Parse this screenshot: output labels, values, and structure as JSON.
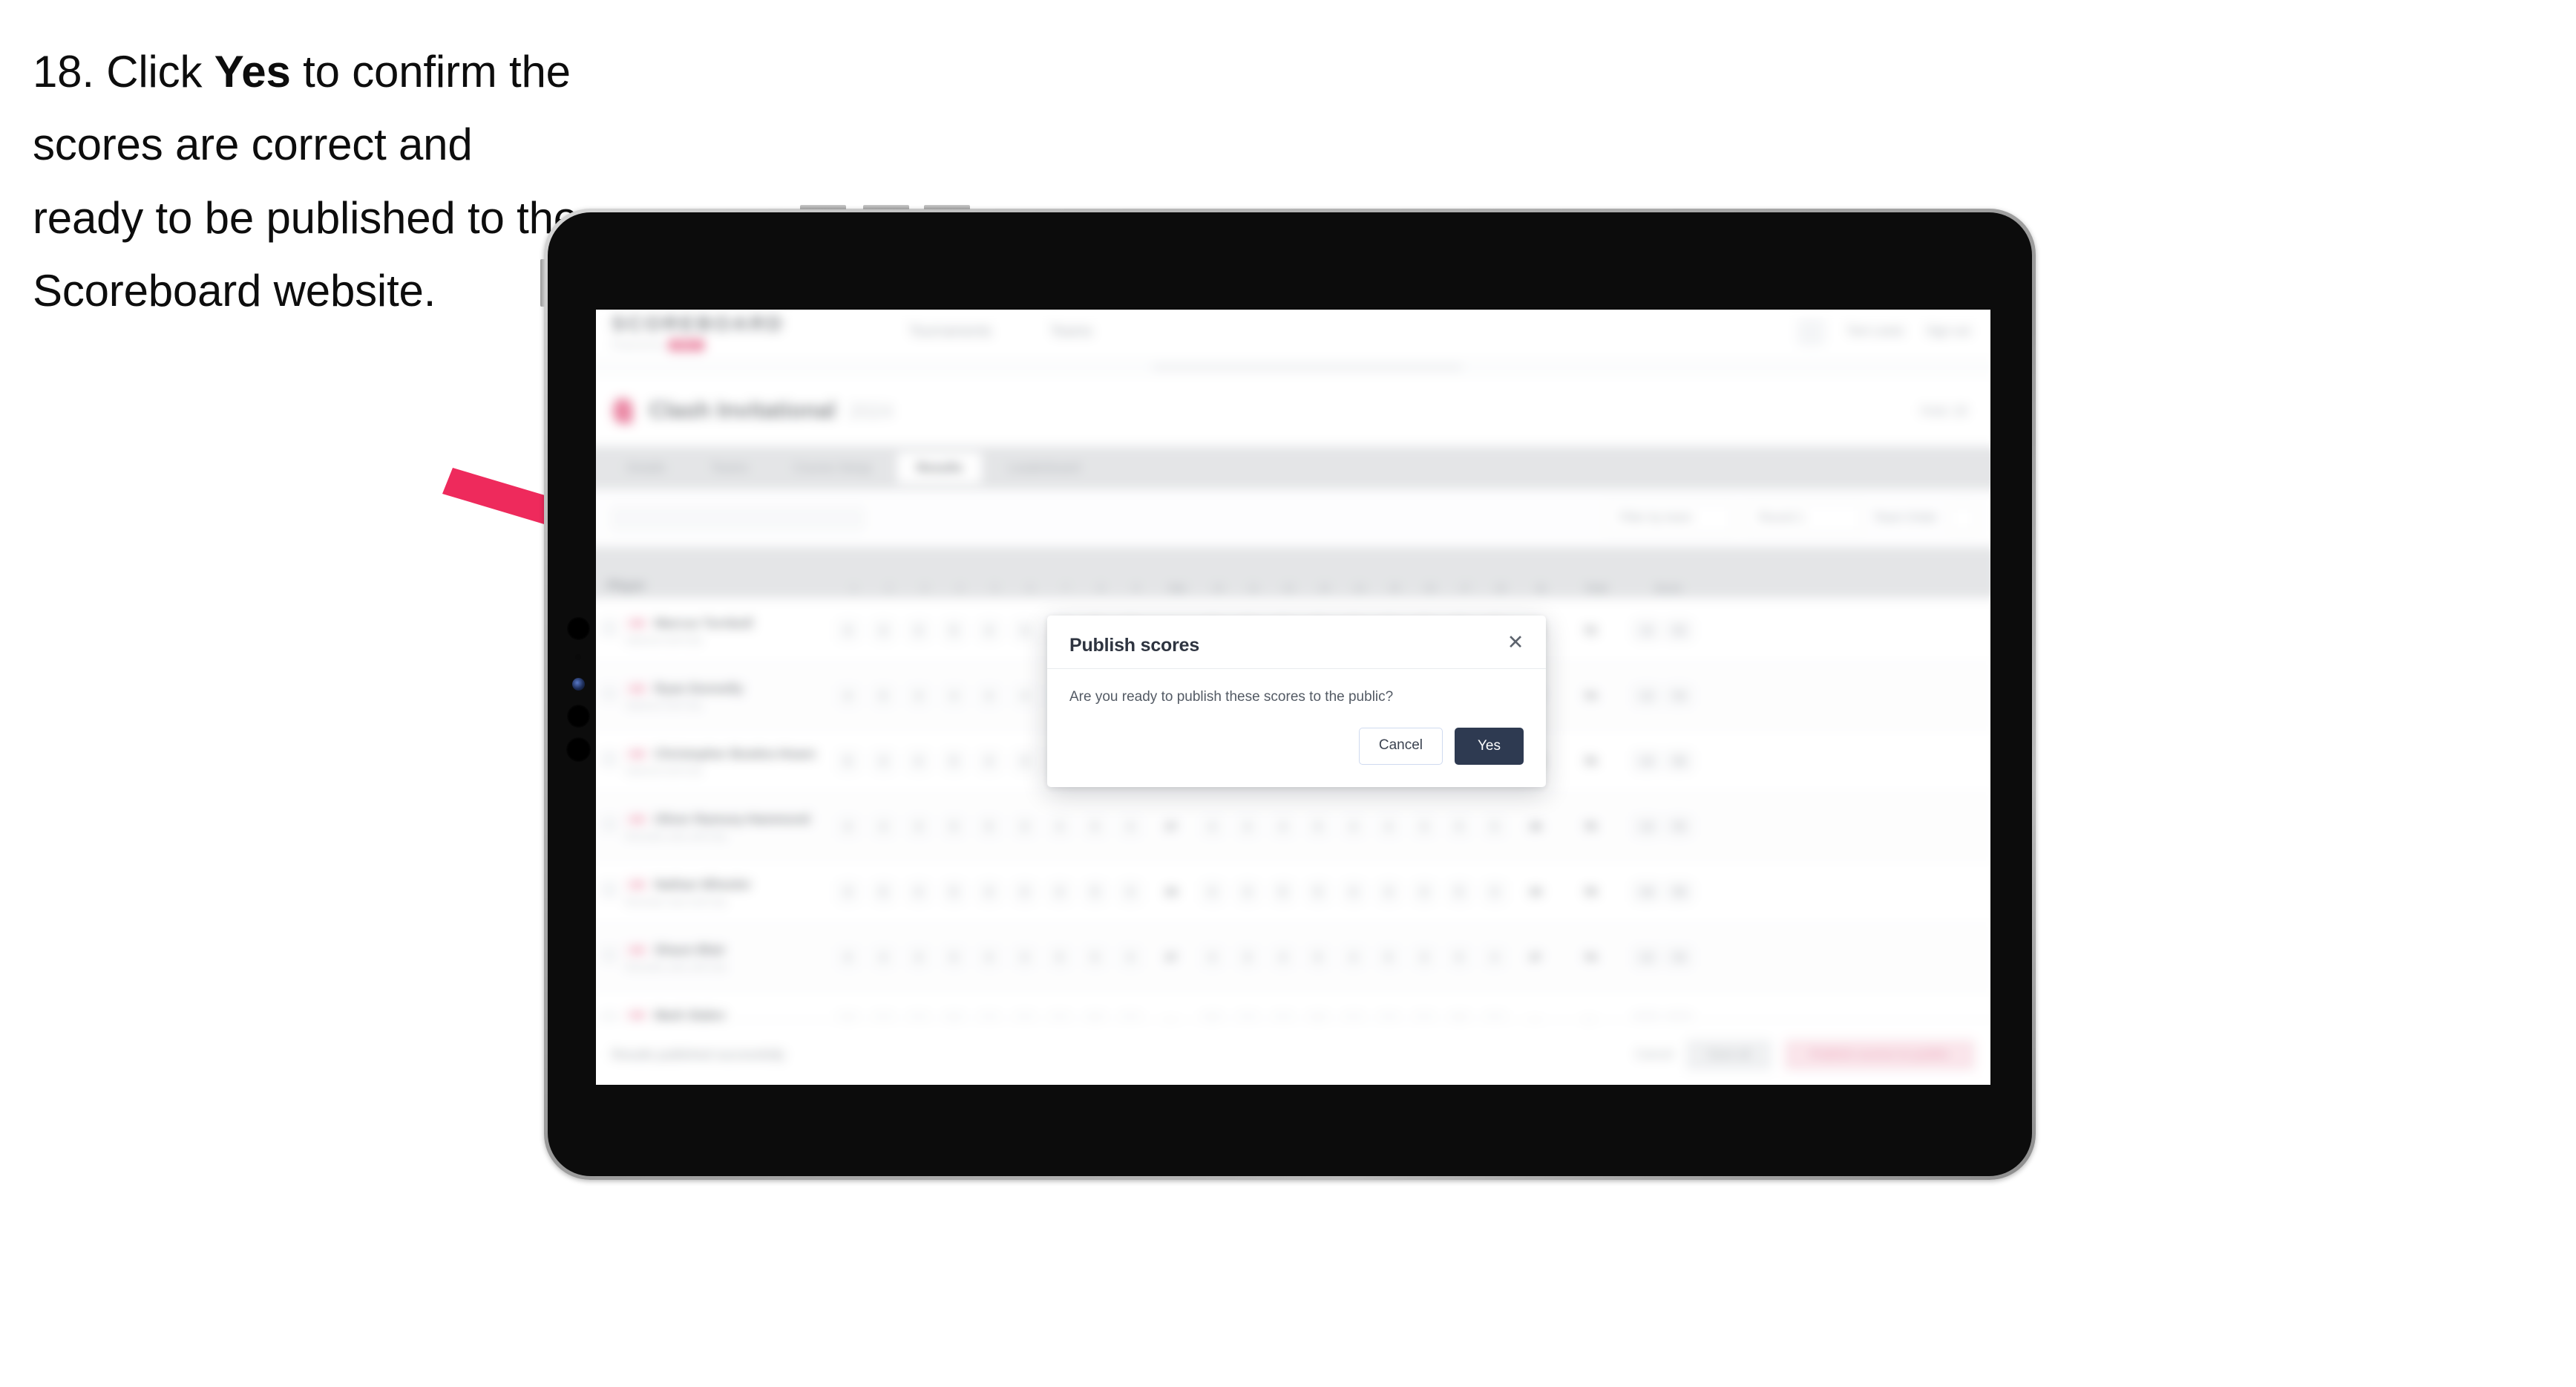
{
  "instruction": {
    "step_number": "18.",
    "text_before": "Click",
    "emphasis": "Yes",
    "text_after": "to confirm the scores are correct and ready to be published to the Scoreboard website."
  },
  "annotation": {
    "arrow_color": "#ee2a5c",
    "arrow_name": "pointer-arrow-to-yes-button"
  },
  "device": {
    "type": "tablet",
    "frame_color": "#b8b8b8",
    "bezel_color": "#0c0c0c"
  },
  "app": {
    "header": {
      "brand": "SCOREBOARD",
      "brand_subtitle": "Powered by",
      "brand_pill": "GOLF",
      "nav": [
        {
          "label": "Tournaments"
        },
        {
          "label": "Teams"
        }
      ],
      "right": [
        {
          "label": "Tom Lewis"
        },
        {
          "label": "Sign out"
        }
      ]
    },
    "title_bar": {
      "title": "Clash Invitational",
      "chip": "2024",
      "action": "Hole 18"
    },
    "tabs": [
      {
        "label": "Details",
        "active": false
      },
      {
        "label": "Teams",
        "active": false
      },
      {
        "label": "Course Setup",
        "active": false
      },
      {
        "label": "Results",
        "active": true
      },
      {
        "label": "Leaderboard",
        "active": false
      }
    ],
    "filters": {
      "search_placeholder": "Search players",
      "pills": [
        {
          "label": "Filter by team"
        },
        {
          "label": "Round 1"
        }
      ],
      "sort_label": "Team Order",
      "icon": "filter-icon"
    },
    "table": {
      "headers": {
        "player": "Player",
        "holes": [
          "1",
          "2",
          "3",
          "4",
          "5",
          "6",
          "7",
          "8",
          "9",
          "10",
          "11",
          "12",
          "13",
          "14",
          "15",
          "16",
          "17",
          "18"
        ],
        "out": "Out",
        "in": "In",
        "total": "Total",
        "score": "Score"
      },
      "rows": [
        {
          "badge": "AM",
          "name": "Marcus Turnbull",
          "club": "Oakmont Golf Club",
          "holes": [
            "4",
            "4",
            "3",
            "5",
            "4",
            "3",
            "4",
            "5",
            "4",
            "4",
            "3",
            "4",
            "5",
            "4",
            "4",
            "3",
            "5",
            "4"
          ],
          "out": "36",
          "in": "36",
          "total": "72",
          "score_a": "-0",
          "score_b": "72"
        },
        {
          "badge": "AM",
          "name": "Ryan Donnelly",
          "club": "Oakmont Golf Club",
          "holes": [
            "4",
            "5",
            "3",
            "4",
            "4",
            "4",
            "4",
            "5",
            "4",
            "4",
            "4",
            "4",
            "5",
            "3",
            "4",
            "4",
            "5",
            "4"
          ],
          "out": "37",
          "in": "37",
          "total": "74",
          "score_a": "+2",
          "score_b": "74"
        },
        {
          "badge": "AM",
          "name": "Christopher Bowles-Hoare",
          "club": "Oakmont Golf Club",
          "holes": [
            "5",
            "4",
            "4",
            "5",
            "4",
            "3",
            "4",
            "5",
            "4",
            "5",
            "3",
            "4",
            "5",
            "4",
            "4",
            "4",
            "5",
            "4"
          ],
          "out": "38",
          "in": "38",
          "total": "76",
          "score_a": "+4",
          "score_b": "76"
        },
        {
          "badge": "AM",
          "name": "Oliver Ramsey-Hammond",
          "club": "Riverside Links Golf Club",
          "holes": [
            "4",
            "4",
            "3",
            "5",
            "5",
            "3",
            "4",
            "5",
            "4",
            "4",
            "4",
            "4",
            "5",
            "4",
            "4",
            "3",
            "5",
            "5"
          ],
          "out": "37",
          "in": "38",
          "total": "75",
          "score_a": "+3",
          "score_b": "75"
        },
        {
          "badge": "AM",
          "name": "Nathan Wheeler",
          "club": "Riverside Links Golf Club",
          "holes": [
            "4",
            "5",
            "4",
            "5",
            "4",
            "4",
            "4",
            "5",
            "4",
            "4",
            "4",
            "5",
            "5",
            "4",
            "4",
            "4",
            "5",
            "4"
          ],
          "out": "39",
          "in": "39",
          "total": "78",
          "score_a": "+6",
          "score_b": "78"
        },
        {
          "badge": "AM",
          "name": "Shaun Blair",
          "club": "Riverside Links Golf Club",
          "holes": [
            "4",
            "4",
            "3",
            "5",
            "4",
            "3",
            "5",
            "5",
            "4",
            "4",
            "3",
            "4",
            "5",
            "4",
            "5",
            "3",
            "5",
            "4"
          ],
          "out": "37",
          "in": "37",
          "total": "74",
          "score_a": "+2",
          "score_b": "74"
        },
        {
          "badge": "AM",
          "name": "Mark Staley",
          "club": "Brackenwood Golf Club",
          "holes": [
            "5",
            "4",
            "4",
            "5",
            "4",
            "4",
            "4",
            "5",
            "4",
            "5",
            "4",
            "4",
            "5",
            "4",
            "4",
            "4",
            "5",
            "4"
          ],
          "out": "39",
          "in": "39",
          "total": "78",
          "score_a": "+6",
          "score_b": "78"
        }
      ]
    },
    "footer": {
      "note": "Results published successfully",
      "cancel_link": "Cancel",
      "save_button": "Save all",
      "publish_button": "Publish scores to public"
    }
  },
  "dialog": {
    "title": "Publish scores",
    "message": "Are you ready to publish these scores to the public?",
    "close_icon": "close-icon",
    "cancel_label": "Cancel",
    "confirm_label": "Yes",
    "confirm_bg": "#2e3a51"
  }
}
